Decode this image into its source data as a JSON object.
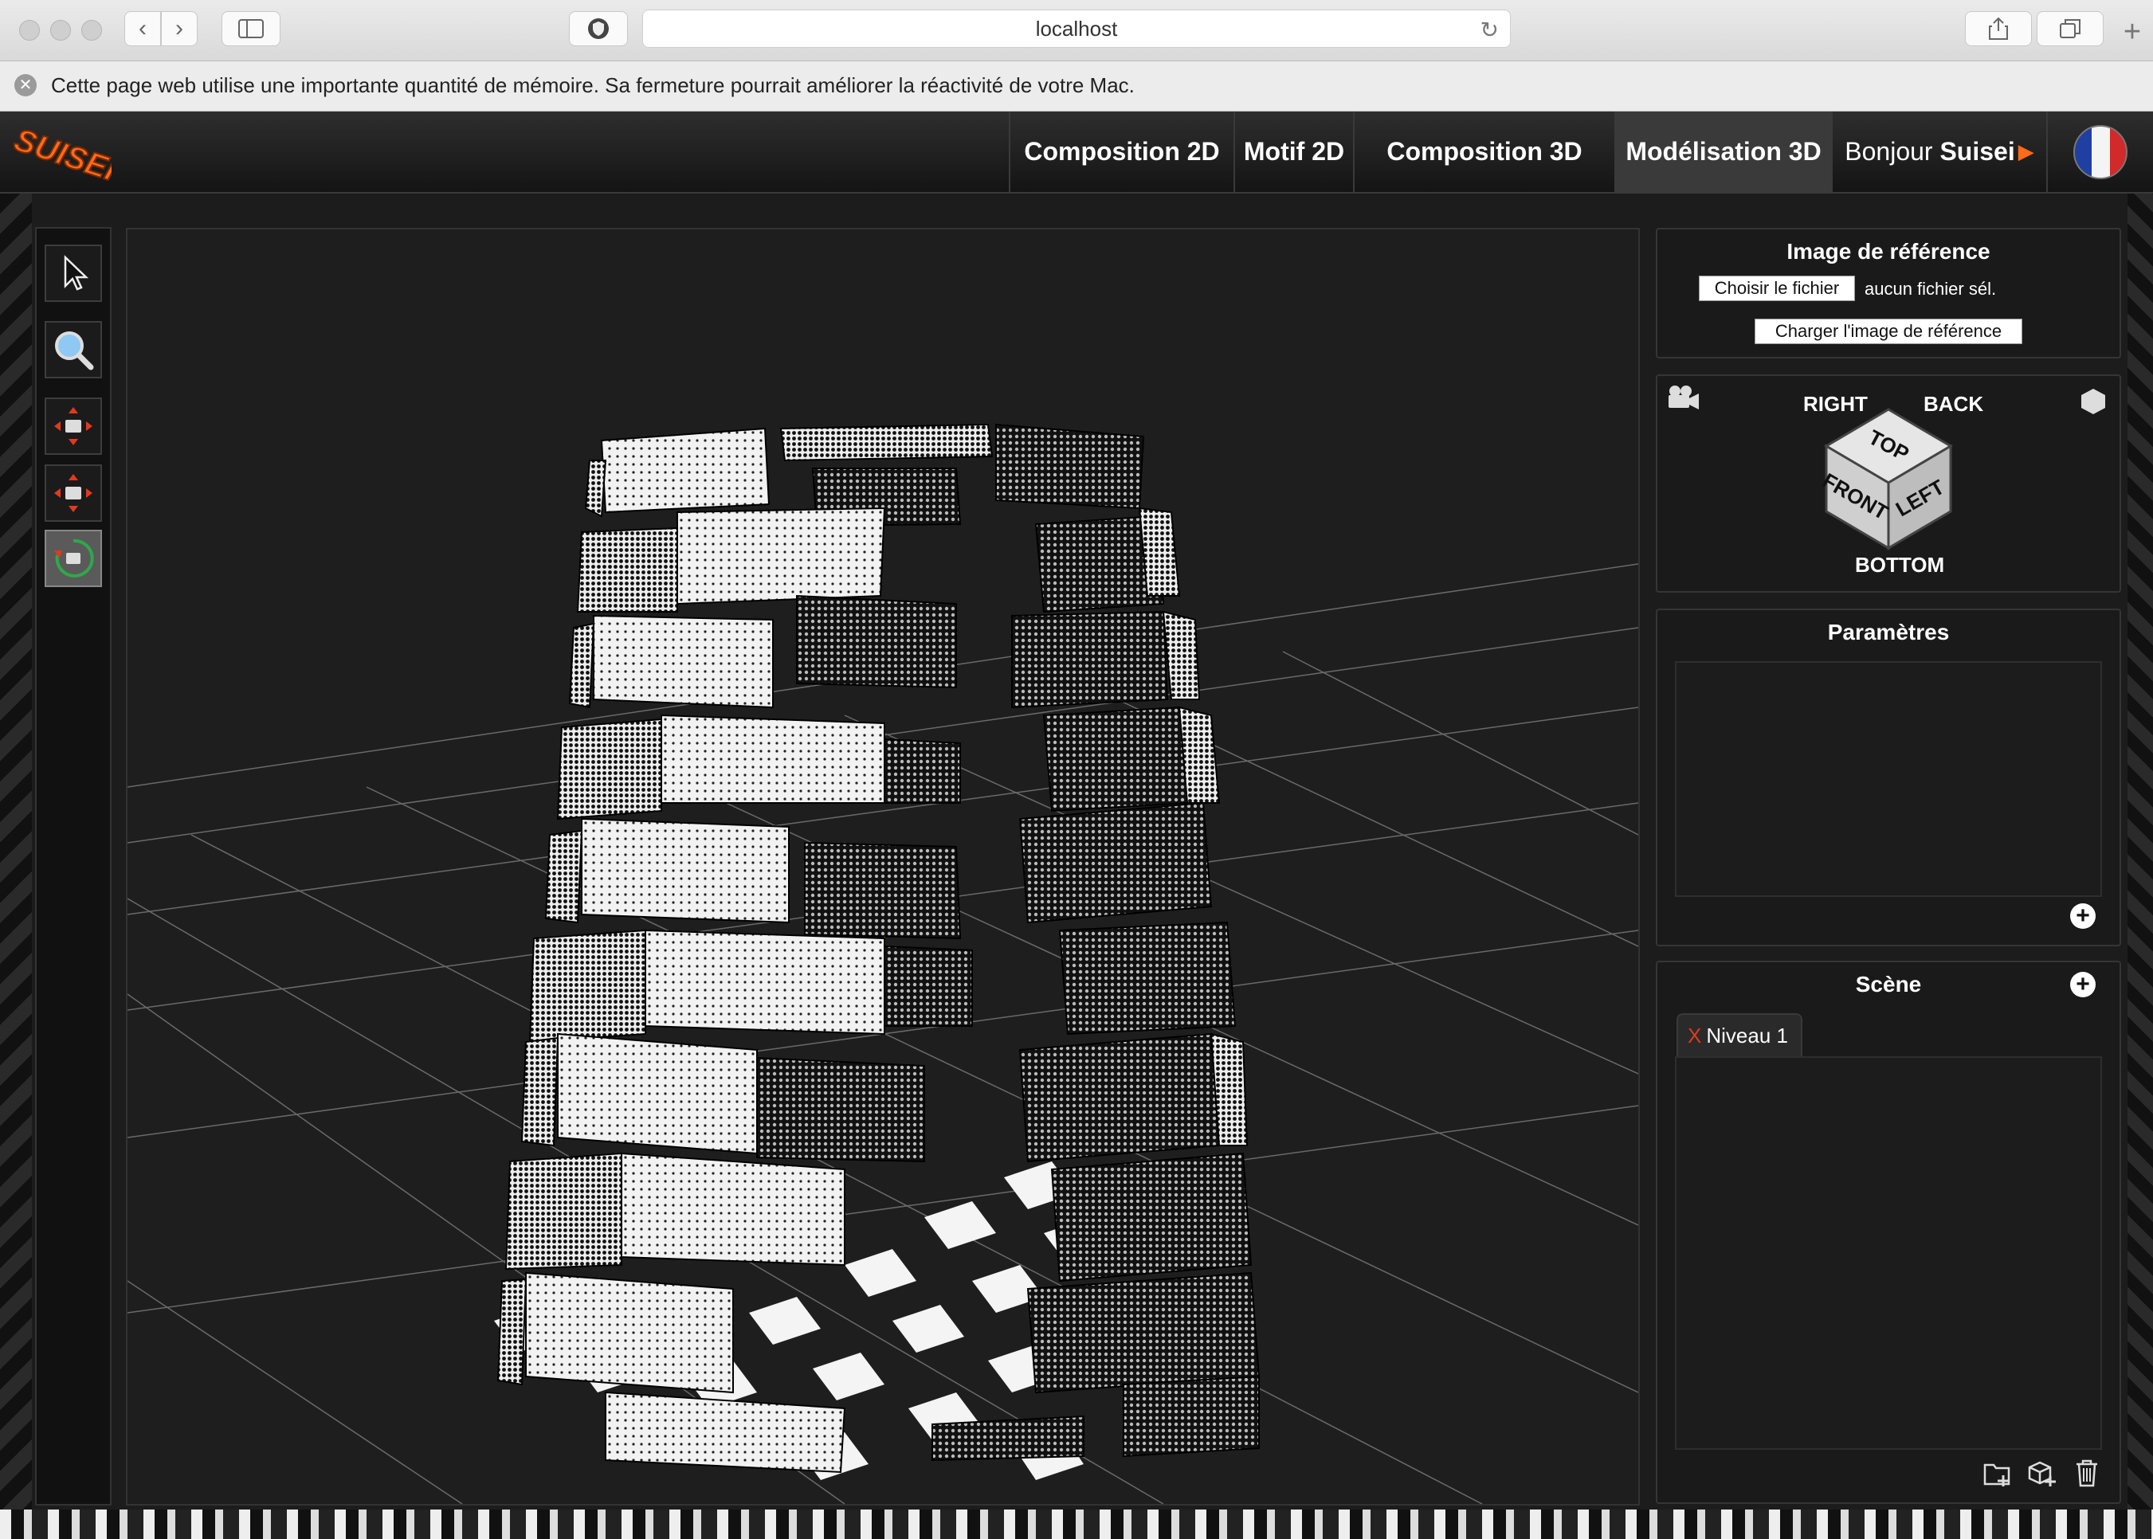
{
  "browser": {
    "url": "localhost",
    "notice": "Cette page web utilise une importante quantité de mémoire. Sa fermeture pourrait améliorer la réactivité de votre Mac."
  },
  "app": {
    "logo": "SUISEI",
    "nav": [
      {
        "label": "Composition 2D"
      },
      {
        "label": "Motif 2D"
      },
      {
        "label": "Composition 3D"
      },
      {
        "label": "Modélisation 3D"
      }
    ],
    "greeting_prefix": "Bonjour ",
    "greeting_name": "Suisei",
    "language_flag": "flag-fr-icon"
  },
  "tools": [
    {
      "name": "select-tool",
      "icon": "cursor-icon"
    },
    {
      "name": "zoom-tool",
      "icon": "magnifier-icon"
    },
    {
      "name": "pan-camera-tool",
      "icon": "camera-move-icon"
    },
    {
      "name": "dolly-camera-tool",
      "icon": "camera-move-icon"
    },
    {
      "name": "orbit-camera-tool",
      "icon": "camera-orbit-icon",
      "active": true
    }
  ],
  "reference": {
    "title": "Image de référence",
    "choose_label": "Choisir le fichier",
    "no_file": "aucun fichier sél.",
    "load_label": "Charger l'image de référence"
  },
  "viewcube": {
    "right": "RIGHT",
    "back": "BACK",
    "top": "TOP",
    "front": "FRONT",
    "left": "LEFT",
    "bottom": "BOTTOM",
    "camera_icon": "camera-icon",
    "perspective_icon": "hexagon-icon"
  },
  "params": {
    "title": "Paramètres"
  },
  "scene": {
    "title": "Scène",
    "tabs": [
      {
        "close": "X",
        "label": "Niveau 1"
      }
    ],
    "footer_icons": [
      "add-folder-icon",
      "add-object-icon",
      "trash-icon"
    ]
  },
  "colors": {
    "accent": "#ff6a1a",
    "close_red": "#e03a1e",
    "panel_bg": "#1a1a1a"
  }
}
